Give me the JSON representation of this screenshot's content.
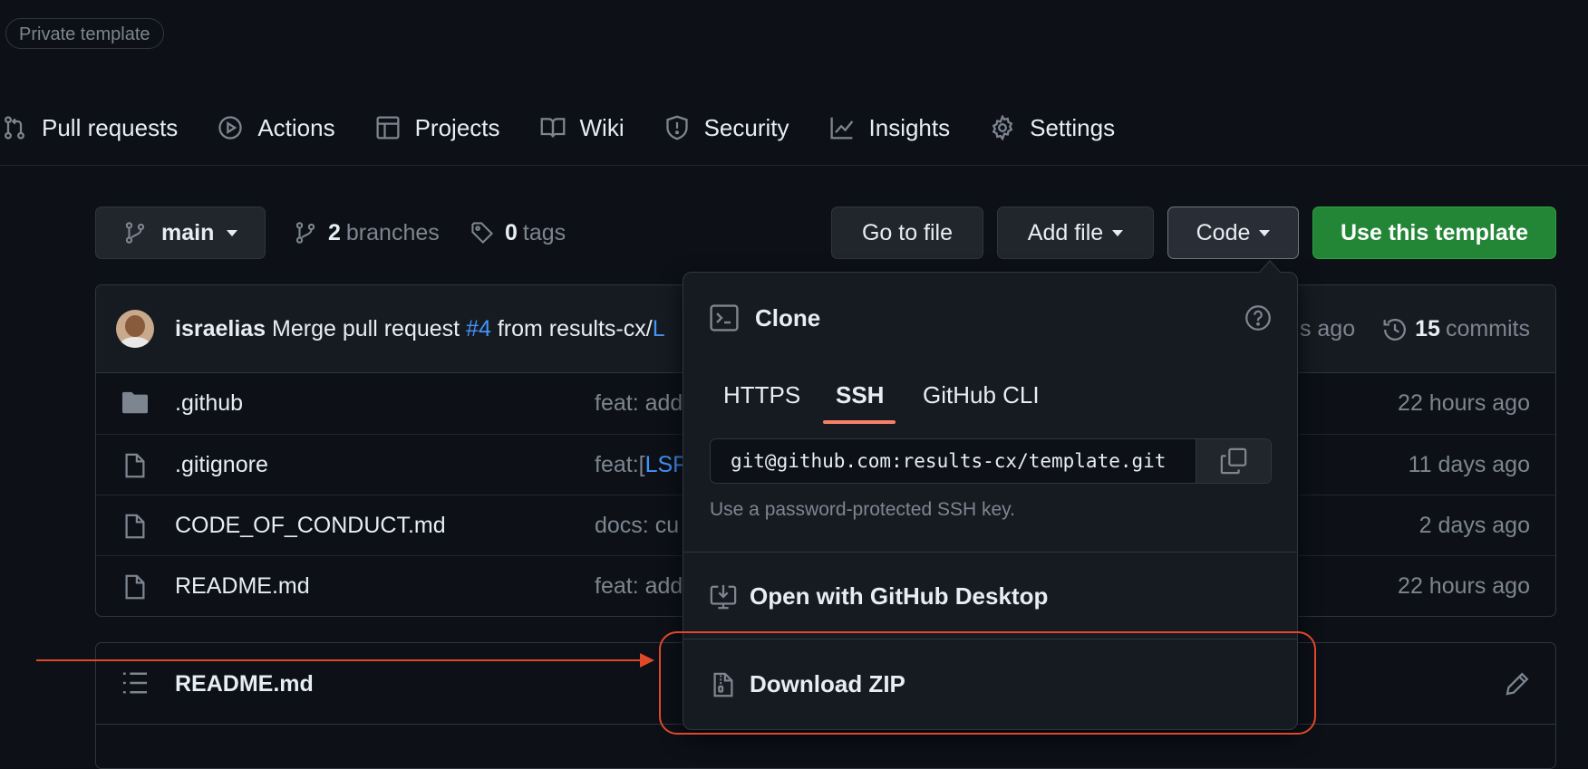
{
  "header": {
    "visibility_badge": "Private template"
  },
  "nav": {
    "items": [
      {
        "label": "Pull requests",
        "icon": "git-pull-request-icon"
      },
      {
        "label": "Actions",
        "icon": "play-icon"
      },
      {
        "label": "Projects",
        "icon": "table-icon"
      },
      {
        "label": "Wiki",
        "icon": "book-icon"
      },
      {
        "label": "Security",
        "icon": "shield-icon"
      },
      {
        "label": "Insights",
        "icon": "graph-icon"
      },
      {
        "label": "Settings",
        "icon": "gear-icon"
      }
    ]
  },
  "toolbar": {
    "branch": "main",
    "branches_count": "2",
    "branches_label": "branches",
    "tags_count": "0",
    "tags_label": "tags",
    "go_to_file": "Go to file",
    "add_file": "Add file",
    "code": "Code",
    "use_template": "Use this template"
  },
  "commit": {
    "author": "israelias",
    "message_prefix": "Merge pull request",
    "pr_link": "#4",
    "message_suffix": "from results-cx/",
    "message_link_fragment": "L",
    "time_fragment": "s ago",
    "commits_count": "15",
    "commits_label": "commits"
  },
  "files": [
    {
      "name": ".github",
      "type": "folder",
      "message": "feat: add",
      "link": "",
      "time": "22 hours ago"
    },
    {
      "name": ".gitignore",
      "type": "file",
      "message": "feat:[",
      "link": "LSP",
      "time": "11 days ago"
    },
    {
      "name": "CODE_OF_CONDUCT.md",
      "type": "file",
      "message": "docs: cu",
      "link": "",
      "time": "2 days ago"
    },
    {
      "name": "README.md",
      "type": "file",
      "message": "feat: add",
      "link": "",
      "time": "22 hours ago"
    }
  ],
  "readme": {
    "title": "README.md"
  },
  "clone": {
    "title": "Clone",
    "tabs": [
      "HTTPS",
      "SSH",
      "GitHub CLI"
    ],
    "active_tab": "SSH",
    "url": "git@github.com:results-cx/template.git",
    "hint": "Use a password-protected SSH key.",
    "open_desktop": "Open with GitHub Desktop",
    "download_zip": "Download ZIP"
  },
  "colors": {
    "background": "#0d1117",
    "accent_green": "#238636",
    "link_blue": "#4493f8",
    "tab_underline": "#f78166",
    "annotation_red": "#e0482a"
  }
}
